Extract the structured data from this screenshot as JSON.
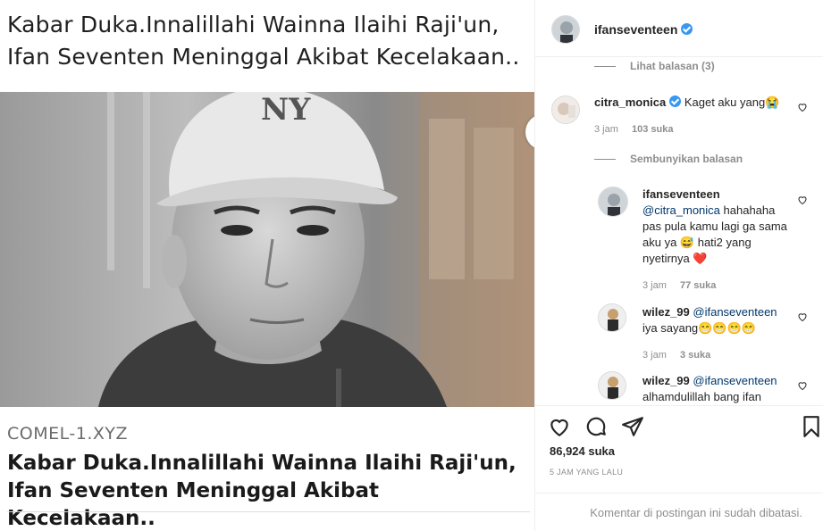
{
  "article": {
    "headline_top": "Kabar Duka.Innalillahi Wainna Ilaihi Raji'un, Ifan Seventen Meninggal Akibat Kecelakaan..",
    "site": "COMEL-1.XYZ",
    "headline_bottom": "Kabar Duka.Innalillahi Wainna Ilaihi Raji'un, Ifan Seventen Meninggal Akibat Kecelakaan..",
    "cap_logo_text": "NY"
  },
  "post": {
    "username": "ifanseventeen",
    "verified": true,
    "likes": "86,924 suka",
    "time_ago": "5 JAM YANG LALU",
    "comments_limited": "Komentar di postingan ini sudah dibatasi."
  },
  "comments": {
    "view_replies": "Lihat balasan (3)",
    "hide_replies": "Sembunyikan balasan",
    "items": [
      {
        "user": "citra_monica",
        "verified": true,
        "text": "Kaget aku yang😭",
        "time": "3 jam",
        "likes": "103 suka"
      },
      {
        "user": "ifanseventeen",
        "verified": false,
        "mention": "@citra_monica",
        "text": " hahahaha pas pula kamu lagi ga sama aku ya 😅 hati2 yang nyetirnya ❤️",
        "time": "3 jam",
        "likes": "77 suka"
      },
      {
        "user": "wilez_99",
        "verified": false,
        "mention": "@ifanseventeen",
        "text": " iya sayang😁😁😁😁",
        "time": "3 jam",
        "likes": "3 suka"
      },
      {
        "user": "wilez_99",
        "verified": false,
        "mention": "@ifanseventeen",
        "text": " alhamdulillah bang ifan"
      }
    ]
  },
  "icons": {
    "like": "heart-icon",
    "comment": "comment-icon",
    "share": "share-icon",
    "save": "bookmark-icon",
    "verified": "verified-badge-icon"
  },
  "colors": {
    "verified": "#3897f0",
    "mention": "#00376b",
    "muted": "#8e8e8e",
    "heart_emoji": "#c0392b"
  }
}
